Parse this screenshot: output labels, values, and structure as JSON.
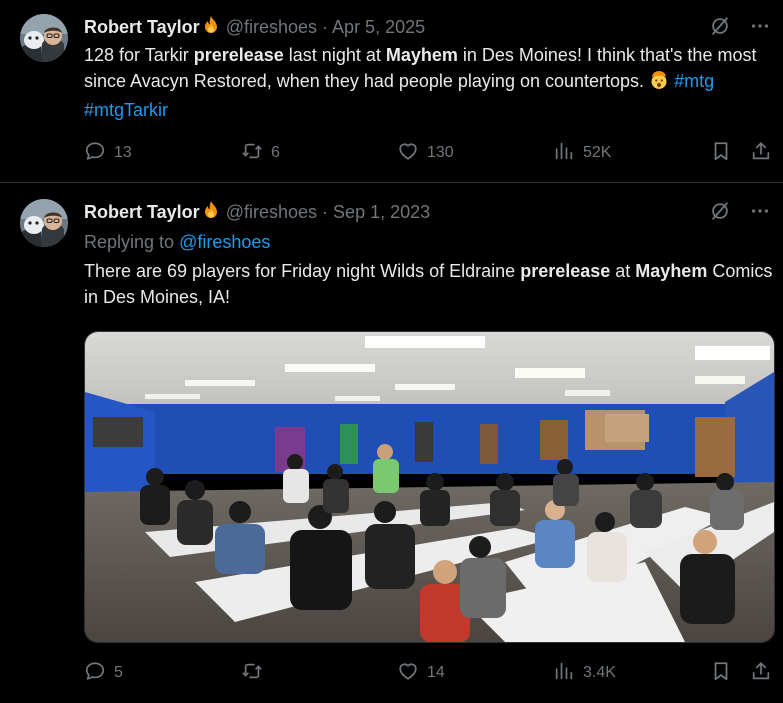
{
  "colors": {
    "background": "#000000",
    "text": "#e7e9ea",
    "muted": "#71767b",
    "link": "#1d9bf0",
    "divider": "#2f3336"
  },
  "tweets": [
    {
      "author": {
        "name": "Robert Taylor",
        "badge_icon": "fire-emoji-icon",
        "handle": "@fireshoes"
      },
      "separator": "·",
      "date": "Apr 5, 2025",
      "text": {
        "p1": "128 for Tarkir ",
        "b1": "prerelease",
        "p2": " last night at ",
        "b2": "Mayhem",
        "p3": " in Des Moines! I think that's the most since Avacyn Restored, when they had people playing on countertops. ",
        "emoji_icon": "exploding-head-emoji-icon",
        "tag1": "#mtg",
        "tag2": "#mtgTarkir"
      },
      "stats": {
        "replies": "13",
        "reposts": "6",
        "likes": "130",
        "views": "52K"
      }
    },
    {
      "author": {
        "name": "Robert Taylor",
        "badge_icon": "fire-emoji-icon",
        "handle": "@fireshoes"
      },
      "separator": "·",
      "date": "Sep 1, 2023",
      "replying_prefix": "Replying to ",
      "replying_to": "@fireshoes",
      "text": {
        "p1": "There are 69 players for Friday night Wilds of Eldraine ",
        "b1": "prerelease",
        "p2": " at ",
        "b2": "Mayhem",
        "p3": " Comics in Des Moines, IA!"
      },
      "media": {
        "type": "photo",
        "subject": "crowded game store room with players at long tables"
      },
      "stats": {
        "replies": "5",
        "reposts": "",
        "likes": "14",
        "views": "3.4K"
      }
    }
  ]
}
